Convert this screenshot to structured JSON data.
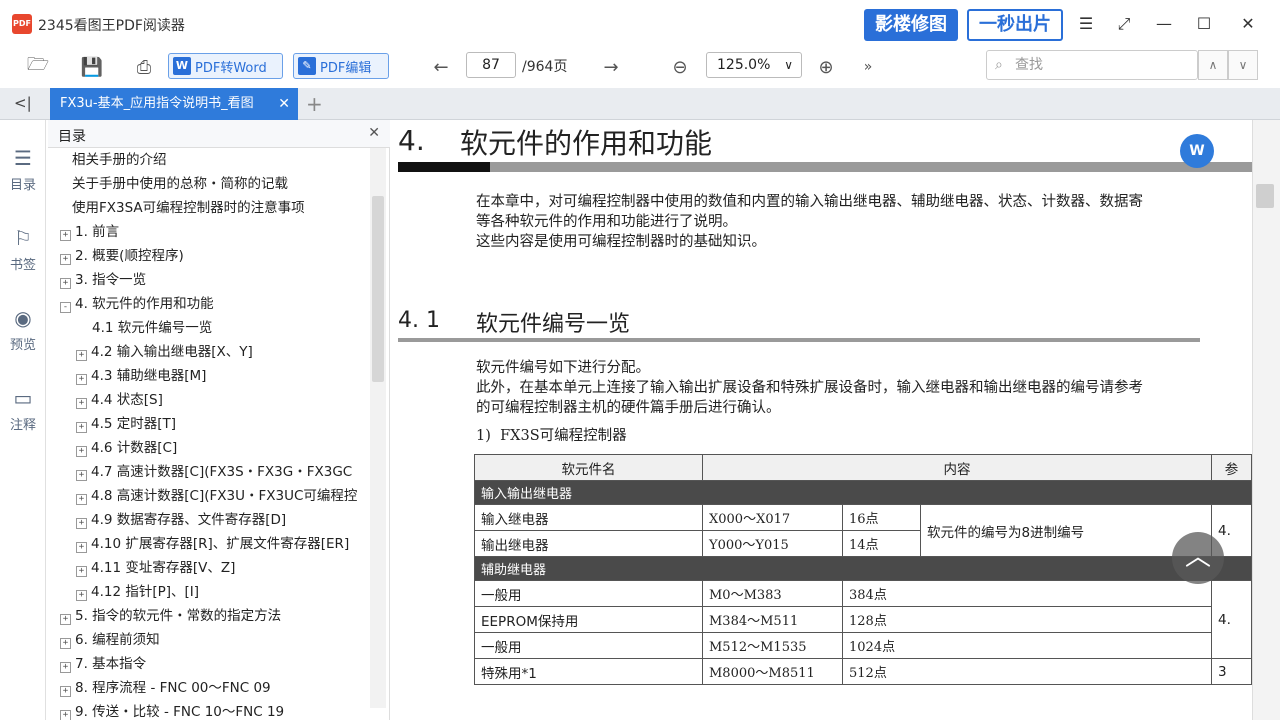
{
  "app": {
    "title": "2345看图王PDF阅读器",
    "logo_text": "PDF",
    "promo_left": "影楼修图",
    "promo_right": "一秒出片"
  },
  "toolbar": {
    "pdf_to_word": "PDF转Word",
    "pdf_edit": "PDF编辑",
    "page_current": "87",
    "page_total": "/964页",
    "zoom": "125.0%",
    "search_placeholder": "查找"
  },
  "tab": {
    "label": "FX3u-基本_应用指令说明书_看图"
  },
  "rail": {
    "items": [
      "目录",
      "书签",
      "预览",
      "注释"
    ]
  },
  "toc": {
    "title": "目录",
    "items": [
      {
        "label": "相关手册的介绍",
        "level": 0,
        "expand": ""
      },
      {
        "label": "关于手册中使用的总称・简称的记载",
        "level": 0,
        "expand": ""
      },
      {
        "label": "使用FX3SA可编程控制器时的注意事项",
        "level": 0,
        "expand": ""
      },
      {
        "label": "1. 前言",
        "level": 0,
        "expand": "+"
      },
      {
        "label": "2. 概要(顺控程序)",
        "level": 0,
        "expand": "+"
      },
      {
        "label": "3. 指令一览",
        "level": 0,
        "expand": "+"
      },
      {
        "label": "4. 软元件的作用和功能",
        "level": 0,
        "expand": "-"
      },
      {
        "label": "4.1 软元件编号一览",
        "level": 1,
        "expand": ""
      },
      {
        "label": "4.2 输入输出继电器[X、Y]",
        "level": 1,
        "expand": "+"
      },
      {
        "label": "4.3 辅助继电器[M]",
        "level": 1,
        "expand": "+"
      },
      {
        "label": "4.4 状态[S]",
        "level": 1,
        "expand": "+"
      },
      {
        "label": "4.5 定时器[T]",
        "level": 1,
        "expand": "+"
      },
      {
        "label": "4.6 计数器[C]",
        "level": 1,
        "expand": "+"
      },
      {
        "label": "4.7 高速计数器[C](FX3S・FX3G・FX3GC",
        "level": 1,
        "expand": "+"
      },
      {
        "label": "4.8 高速计数器[C](FX3U・FX3UC可编程控",
        "level": 1,
        "expand": "+"
      },
      {
        "label": "4.9 数据寄存器、文件寄存器[D]",
        "level": 1,
        "expand": "+"
      },
      {
        "label": "4.10 扩展寄存器[R]、扩展文件寄存器[ER]",
        "level": 1,
        "expand": "+"
      },
      {
        "label": "4.11 变址寄存器[V、Z]",
        "level": 1,
        "expand": "+"
      },
      {
        "label": "4.12 指针[P]、[I]",
        "level": 1,
        "expand": "+"
      },
      {
        "label": "5. 指令的软元件・常数的指定方法",
        "level": 0,
        "expand": "+"
      },
      {
        "label": "6. 编程前须知",
        "level": 0,
        "expand": "+"
      },
      {
        "label": "7. 基本指令",
        "level": 0,
        "expand": "+"
      },
      {
        "label": "8. 程序流程 - FNC 00～FNC 09",
        "level": 0,
        "expand": "+"
      },
      {
        "label": "9. 传送・比较 - FNC 10～FNC 19",
        "level": 0,
        "expand": "+"
      }
    ]
  },
  "doc": {
    "h1_num": "4.",
    "h1_text": "软元件的作用和功能",
    "intro_1": "在本章中，对可编程控制器中使用的数值和内置的输入输出继电器、辅助继电器、状态、计数器、数据寄",
    "intro_2": "等各种软元件的作用和功能进行了说明。",
    "intro_3": "这些内容是使用可编程控制器时的基础知识。",
    "h2_num": "4. 1",
    "h2_text": "软元件编号一览",
    "p1": "软元件编号如下进行分配。",
    "p2": "此外，在基本单元上连接了输入输出扩展设备和特殊扩展设备时，输入继电器和输出继电器的编号请参考",
    "p3": "的可编程控制器主机的硬件篇手册后进行确认。",
    "item1_num": "1)",
    "item1_text": "FX3S可编程控制器",
    "table": {
      "head": [
        "软元件名",
        "内容",
        "参"
      ],
      "group1": "输入输出继电器",
      "rows1": [
        {
          "name": "输入继电器",
          "range": "X000～X017",
          "count": "16点",
          "note": "软元件的编号为8进制编号",
          "ref": "4."
        },
        {
          "name": "输出继电器",
          "range": "Y000～Y015",
          "count": "14点",
          "note": "",
          "ref": ""
        }
      ],
      "group2": "辅助继电器",
      "rows2": [
        {
          "name": "一般用",
          "range": "M0～M383",
          "count": "384点",
          "ref": ""
        },
        {
          "name": "EEPROM保持用",
          "range": "M384～M511",
          "count": "128点",
          "ref": "4."
        },
        {
          "name": "一般用",
          "range": "M512～M1535",
          "count": "1024点",
          "ref": ""
        },
        {
          "name": "特殊用*1",
          "range": "M8000～M8511",
          "count": "512点",
          "ref": "3"
        }
      ]
    }
  }
}
